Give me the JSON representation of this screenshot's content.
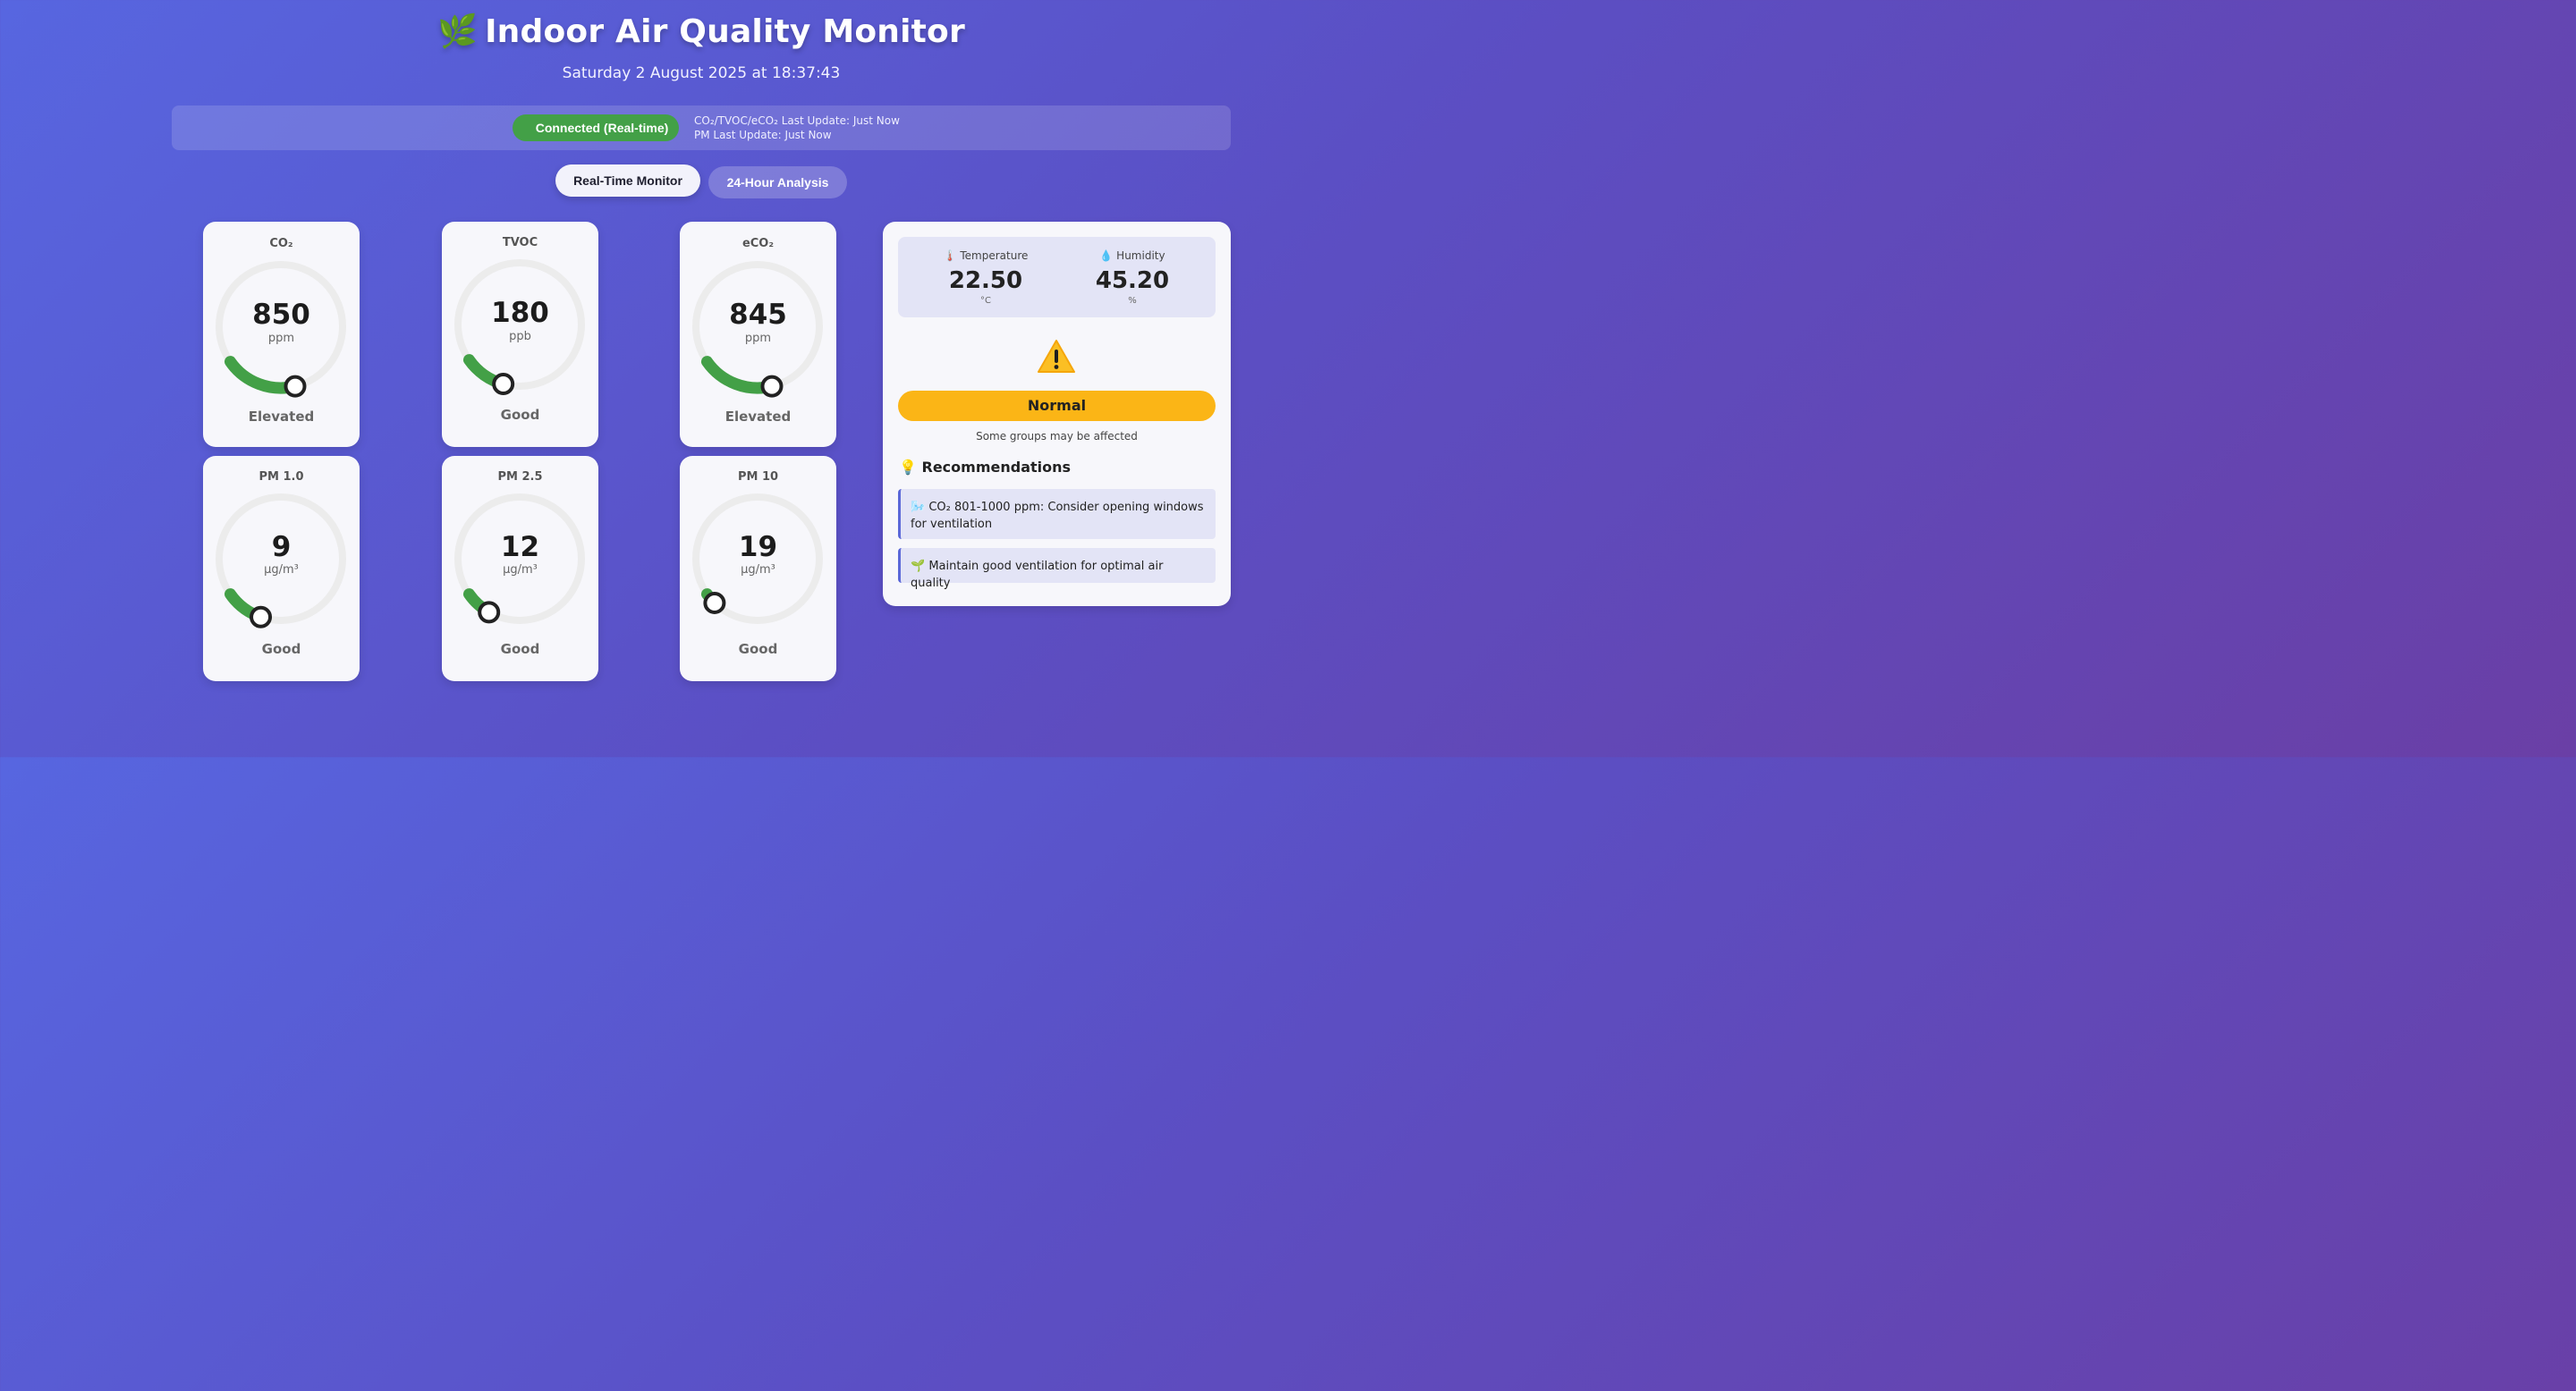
{
  "header": {
    "leaf_icon": "🌿",
    "title": "Indoor Air Quality Monitor",
    "datetime": "Saturday 2 August 2025 at 18:37:43"
  },
  "status": {
    "connection": "Connected (Real-time)",
    "update_line_1": "CO₂/TVOC/eCO₂ Last Update: Just Now",
    "update_line_2": "PM Last Update: Just Now"
  },
  "tabs": [
    {
      "label": "Real-Time Monitor",
      "active": true
    },
    {
      "label": "24-Hour Analysis",
      "active": false
    }
  ],
  "sensors": [
    {
      "id": "co2",
      "title": "CO₂",
      "value": "850",
      "unit": "ppm",
      "status": "Elevated",
      "level": 0.19
    },
    {
      "id": "tvoc",
      "title": "TVOC",
      "value": "180",
      "unit": "ppb",
      "status": "Good",
      "level": 0.11
    },
    {
      "id": "eco2",
      "title": "eCO₂",
      "value": "845",
      "unit": "ppm",
      "status": "Elevated",
      "level": 0.19
    },
    {
      "id": "pm1",
      "title": "PM 1.0",
      "value": "9",
      "unit": "μg/m³",
      "status": "Good",
      "level": 0.1
    },
    {
      "id": "pm25",
      "title": "PM 2.5",
      "value": "12",
      "unit": "μg/m³",
      "status": "Good",
      "level": 0.07
    },
    {
      "id": "pm10",
      "title": "PM 10",
      "value": "19",
      "unit": "μg/m³",
      "status": "Good",
      "level": 0.03
    }
  ],
  "environment": {
    "temperature": {
      "icon": "🌡️",
      "label": "Temperature",
      "value": "22.50",
      "unit": "°C"
    },
    "humidity": {
      "icon": "💧",
      "label": "Humidity",
      "value": "45.20",
      "unit": "%"
    }
  },
  "air_quality": {
    "icon": "warning-icon",
    "level": "Normal",
    "level_color": "#fbb516",
    "description": "Some groups may be affected"
  },
  "recommendations": {
    "icon": "💡",
    "heading": "Recommendations",
    "items": [
      {
        "icon": "🌬️",
        "text": "CO₂ 801-1000 ppm: Consider opening windows for ventilation"
      },
      {
        "icon": "🌱",
        "text": "Maintain good ventilation for optimal air quality"
      }
    ]
  },
  "colors": {
    "gauge_fill": "#43a047",
    "gauge_track": "#ececec",
    "accent": "#5a67d8"
  }
}
